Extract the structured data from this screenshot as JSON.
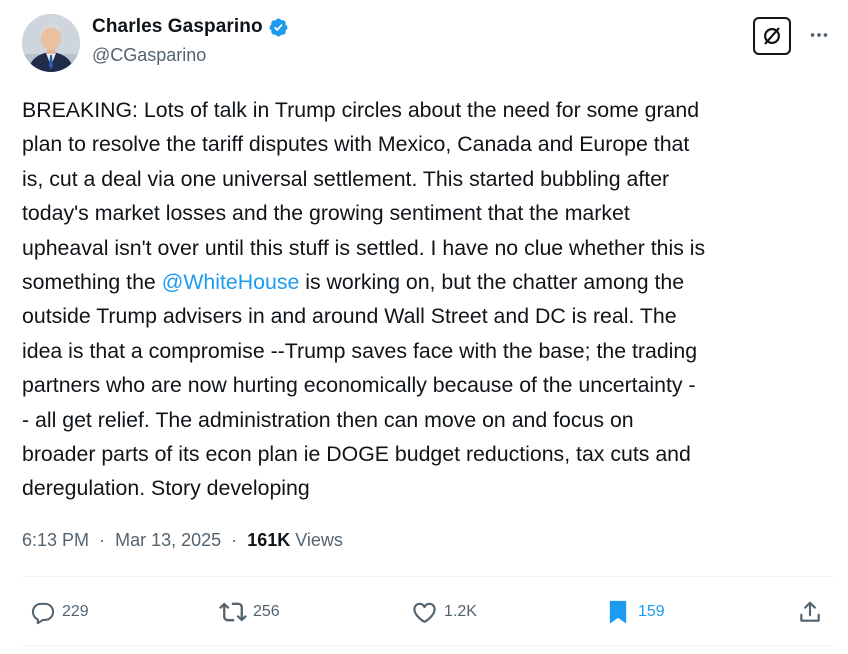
{
  "author": {
    "display_name": "Charles Gasparino",
    "handle": "@CGasparino",
    "verified": true
  },
  "tweet": {
    "lines": [
      {
        "segments": [
          {
            "text": "BREAKING: Lots of talk in Trump circles about the need for some grand"
          }
        ]
      },
      {
        "segments": [
          {
            "text": "plan to resolve the tariff disputes with Mexico, Canada and Europe that"
          }
        ]
      },
      {
        "segments": [
          {
            "text": "is, cut a deal via one universal settlement. This started bubbling after"
          }
        ]
      },
      {
        "segments": [
          {
            "text": "today's market losses and the growing sentiment that the market"
          }
        ]
      },
      {
        "segments": [
          {
            "text": "upheaval isn't over until this stuff is settled. I have no clue whether this is"
          }
        ]
      },
      {
        "segments": [
          {
            "text": "something the "
          },
          {
            "text": "@WhiteHouse",
            "mention": true
          },
          {
            "text": " is working on, but the chatter among the"
          }
        ]
      },
      {
        "segments": [
          {
            "text": "outside Trump advisers in and around Wall Street and DC is real. The"
          }
        ]
      },
      {
        "segments": [
          {
            "text": "idea is that a compromise --Trump saves face with the base; the trading"
          }
        ]
      },
      {
        "segments": [
          {
            "text": "partners who are now hurting economically because of the uncertainty -"
          }
        ]
      },
      {
        "segments": [
          {
            "text": "- all get relief. The administration then can move on and focus on"
          }
        ]
      },
      {
        "segments": [
          {
            "text": "broader parts of its econ plan ie DOGE budget reductions, tax cuts and"
          }
        ]
      },
      {
        "segments": [
          {
            "text": "deregulation. Story developing"
          }
        ]
      }
    ],
    "time": "6:13 PM",
    "separator": "·",
    "date": "Mar 13, 2025",
    "views_count": "161K",
    "views_label": "Views"
  },
  "actions": {
    "replies": "229",
    "reposts": "256",
    "likes": "1.2K",
    "bookmarks": "159"
  },
  "colors": {
    "accent": "#1d9bf0",
    "text": "#0f1419",
    "muted": "#536471"
  },
  "icons": {
    "grok": "grok-icon",
    "more": "more-icon",
    "reply": "reply-icon",
    "repost": "repost-icon",
    "like": "like-icon",
    "bookmark": "bookmark-icon",
    "share": "share-icon",
    "verified": "verified-badge-icon"
  }
}
